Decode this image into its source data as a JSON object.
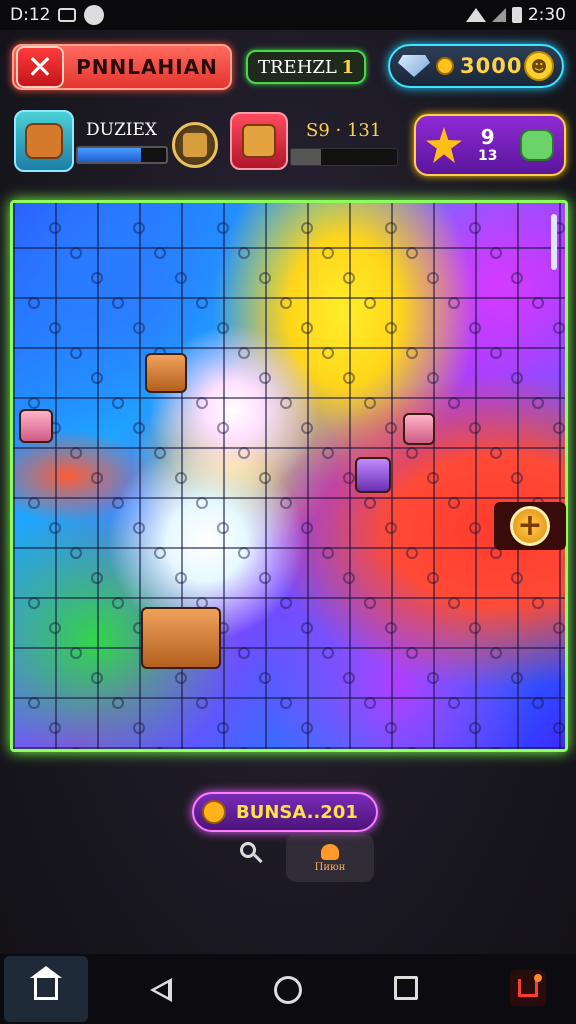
{
  "status_bar": {
    "time_left": "D:12",
    "time_right": "2:30"
  },
  "header": {
    "title": "PNNLAHIAN",
    "close_glyph": "✕",
    "level_label": "TREHZL",
    "level_value": "1",
    "coins": "3000",
    "smile_glyph": "☻"
  },
  "player1": {
    "name": "DUZIEX",
    "progress": 0.72
  },
  "player2": {
    "score": "S9 · 131",
    "progress": 0.28
  },
  "reward": {
    "top": "9",
    "bottom": "13"
  },
  "board": {
    "plus_glyph": "+"
  },
  "bottom": {
    "bonus_text": "BUNSA..201",
    "room_label": "Пиюн"
  },
  "icons": {
    "close": "close-icon",
    "gem": "gem-icon",
    "coin": "coin-icon",
    "smile": "smile-icon",
    "star": "star-icon",
    "plus": "plus-icon",
    "search": "search-icon",
    "home": "home-icon",
    "back": "back-icon",
    "recent": "recent-apps-icon",
    "share": "share-icon"
  },
  "colors": {
    "board_glow": "#8dff5a",
    "title_red": "#e2362f",
    "coin_cyan": "#3ee7ff",
    "reward_purple": "#8f2ad6",
    "bonus_pink": "#ff7cff"
  }
}
